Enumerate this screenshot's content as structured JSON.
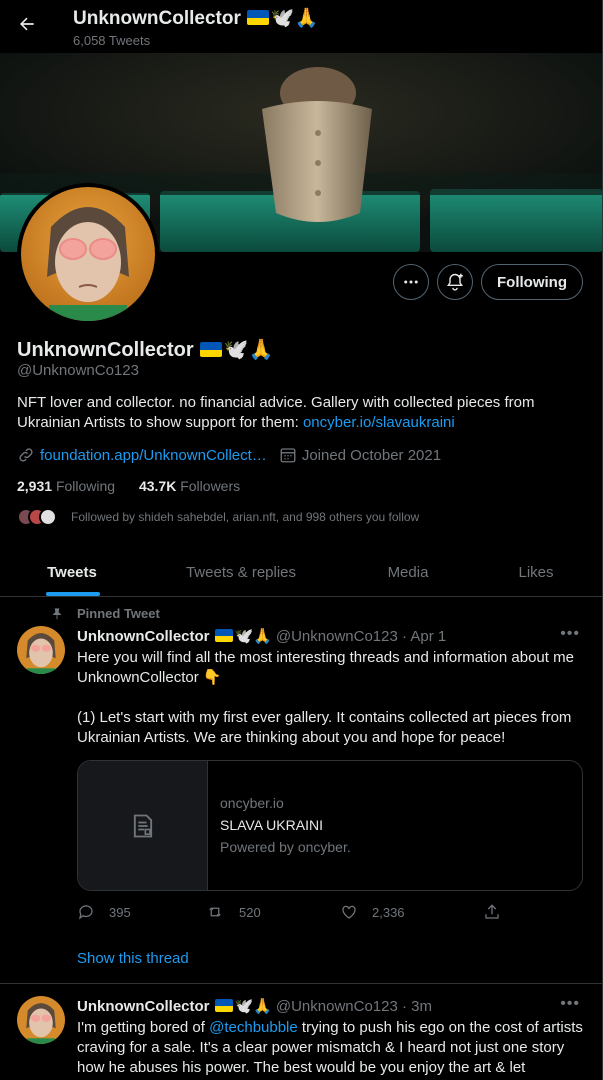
{
  "header": {
    "name": "UnknownCollector",
    "emoji": "🕊️🙏",
    "tweet_count": "6,058 Tweets"
  },
  "profile": {
    "name": "UnknownCollector",
    "emoji": "🕊️🙏",
    "handle": "@UnknownCo123",
    "bio_text": "NFT lover and collector. no financial advice. Gallery with collected pieces from Ukrainian Artists to show support for them: ",
    "bio_link": "oncyber.io/slavaukraini",
    "website": "foundation.app/UnknownCollect…",
    "joined": "Joined October 2021",
    "following_count": "2,931",
    "following_label": "Following",
    "followers_count": "43.7K",
    "followers_label": "Followers",
    "followed_by": "Followed by shideh sahebdel, arian.nft, and 998 others you follow"
  },
  "actions": {
    "follow_button": "Following",
    "more_icon": "more-icon",
    "notify_icon": "notification-bell-icon"
  },
  "tabs": [
    {
      "label": "Tweets",
      "active": true
    },
    {
      "label": "Tweets & replies",
      "active": false
    },
    {
      "label": "Media",
      "active": false
    },
    {
      "label": "Likes",
      "active": false
    }
  ],
  "pinned_tweet": {
    "pinned_label": "Pinned Tweet",
    "name": "UnknownCollector",
    "emoji": "🕊️🙏",
    "handle_time": "@UnknownCo123 · Apr 1",
    "text_line1": "Here you will find all the most interesting threads and information about me UnknownCollector 👇",
    "text_line2": "(1) Let's start with my first ever gallery. It contains collected art pieces from Ukrainian Artists. We are thinking about you and hope for peace!",
    "card": {
      "domain": "oncyber.io",
      "title": "SLAVA UKRAINI",
      "description": "Powered by oncyber."
    },
    "replies": "395",
    "retweets": "520",
    "likes": "2,336",
    "show_thread": "Show this thread"
  },
  "second_tweet": {
    "name": "UnknownCollector",
    "emoji": "🕊️🙏",
    "handle_time": "@UnknownCo123 · 3m",
    "mention": "@techbubble",
    "text_before": "I'm getting bored of ",
    "text_after": " trying to push his ego on the cost of artists craving for a sale. It's a clear power mismatch & I heard not just one story how he abuses his power. The best would be you enjoy the art & let"
  },
  "colors": {
    "background": "#000000",
    "accent": "#1d9bf0",
    "text": "#e7e9ea",
    "secondary_text": "#71767b",
    "border": "#2f3336",
    "flag_blue": "#0057b7",
    "flag_yellow": "#ffd700"
  }
}
